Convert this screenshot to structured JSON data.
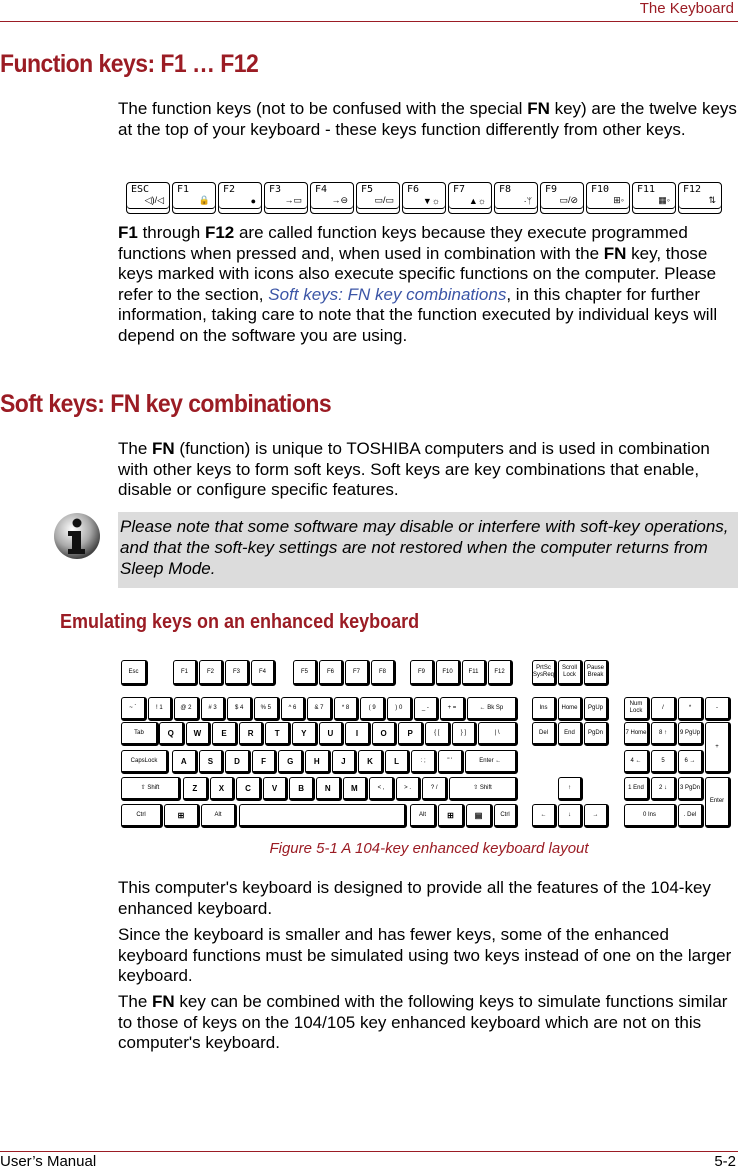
{
  "header": {
    "title": "The Keyboard"
  },
  "section1": {
    "heading": "Function keys: F1 … F12",
    "para1_a": "The function keys (not to be confused with the special ",
    "para1_b": "FN",
    "para1_c": " key) are the twelve keys at the top of your keyboard - these keys function differently from other keys.",
    "fkeys": [
      {
        "label": "ESC",
        "icon": "speaker-mute-icon",
        "glyph": "◁)/◁"
      },
      {
        "label": "F1",
        "icon": "lock-icon",
        "glyph": "🔒"
      },
      {
        "label": "F2",
        "icon": "power-plan-icon",
        "glyph": "●"
      },
      {
        "label": "F3",
        "icon": "sleep-icon",
        "glyph": "→▭"
      },
      {
        "label": "F4",
        "icon": "hibernate-icon",
        "glyph": "→⊖"
      },
      {
        "label": "F5",
        "icon": "display-switch-icon",
        "glyph": "▭/▭"
      },
      {
        "label": "F6",
        "icon": "brightness-down-icon",
        "glyph": "▼☼"
      },
      {
        "label": "F7",
        "icon": "brightness-up-icon",
        "glyph": "▲☼"
      },
      {
        "label": "F8",
        "icon": "wireless-icon",
        "glyph": "·ᛘ"
      },
      {
        "label": "F9",
        "icon": "touchpad-icon",
        "glyph": "▭/⊘"
      },
      {
        "label": "F10",
        "icon": "arrow-mode-icon",
        "glyph": "⊞◦"
      },
      {
        "label": "F11",
        "icon": "numeric-mode-icon",
        "glyph": "▦◦"
      },
      {
        "label": "F12",
        "icon": "scroll-lock-icon",
        "glyph": "⇅"
      }
    ],
    "para2_a": "F1",
    "para2_b": " through ",
    "para2_c": "F12",
    "para2_d": " are called function keys because they execute programmed functions when pressed and, when used in combination with the ",
    "para2_e": "FN",
    "para2_f": " key, those keys marked with icons also execute specific functions on the computer. Please refer to the section, ",
    "para2_link": "Soft keys: FN key combinations",
    "para2_g": ", in this chapter for further information, taking care to note that the function executed by individual keys will depend on the software you are using."
  },
  "section2": {
    "heading": "Soft keys: FN key combinations",
    "para1_a": "The ",
    "para1_b": "FN",
    "para1_c": " (function) is unique to TOSHIBA computers and is used in combination with other keys to form soft keys. Soft keys are key combinations that enable, disable or configure specific features.",
    "note": "Please note that some software may disable or interfere with soft-key operations, and that the soft-key settings are not restored when the computer returns from Sleep Mode."
  },
  "section3": {
    "heading": "Emulating keys on an enhanced keyboard",
    "caption": "Figure 5-1 A 104-key enhanced keyboard layout",
    "para1": "This computer's keyboard is designed to provide all the features of the 104-key enhanced keyboard.",
    "para2": "Since the keyboard is smaller and has fewer keys, some of the enhanced keyboard functions must be simulated using two keys instead of one on the larger keyboard.",
    "para3_a": "The ",
    "para3_b": "FN",
    "para3_c": " key can be combined with the following keys to simulate functions similar to those of keys on the 104/105 key enhanced keyboard which are not on this computer's keyboard."
  },
  "keyboard": {
    "row0": [
      "Esc",
      "F1",
      "F2",
      "F3",
      "F4",
      "F5",
      "F6",
      "F7",
      "F8",
      "F9",
      "F10",
      "F11",
      "F12",
      "PrtSc SysReq",
      "Scroll Lock",
      "Pause Break"
    ],
    "row1": [
      "~ `",
      "! 1",
      "@ 2",
      "# 3",
      "$ 4",
      "% 5",
      "^ 6",
      "& 7",
      "* 8",
      "( 9",
      ") 0",
      "_ -",
      "+ =",
      "← Bk Sp"
    ],
    "row2": [
      "Tab",
      "Q",
      "W",
      "E",
      "R",
      "T",
      "Y",
      "U",
      "I",
      "O",
      "P",
      "{ [",
      "} ]",
      "| \\"
    ],
    "row3": [
      "CapsLock",
      "A",
      "S",
      "D",
      "F",
      "G",
      "H",
      "J",
      "K",
      "L",
      ": ;",
      "\" '",
      "Enter ←"
    ],
    "row4": [
      "⇧ Shift",
      "Z",
      "X",
      "C",
      "V",
      "B",
      "N",
      "M",
      "< ,",
      "> .",
      "? /",
      "⇧ Shift"
    ],
    "row5": [
      "Ctrl",
      "⊞",
      "Alt",
      "",
      "Alt",
      "⊞",
      "▤",
      "Ctrl"
    ],
    "nav": [
      "Ins",
      "Home",
      "PgUp",
      "Del",
      "End",
      "PgDn",
      "↑",
      "←",
      "↓",
      "→"
    ],
    "numpad": [
      "Num Lock",
      "/",
      "*",
      "-",
      "7 Home",
      "8 ↑",
      "9 PgUp",
      "+",
      "4 ←",
      "5",
      "6 →",
      "1 End",
      "2 ↓",
      "3 PgDn",
      "Enter",
      "0 Ins",
      ". Del"
    ]
  },
  "footer": {
    "left": "User’s Manual",
    "right": "5-2"
  }
}
